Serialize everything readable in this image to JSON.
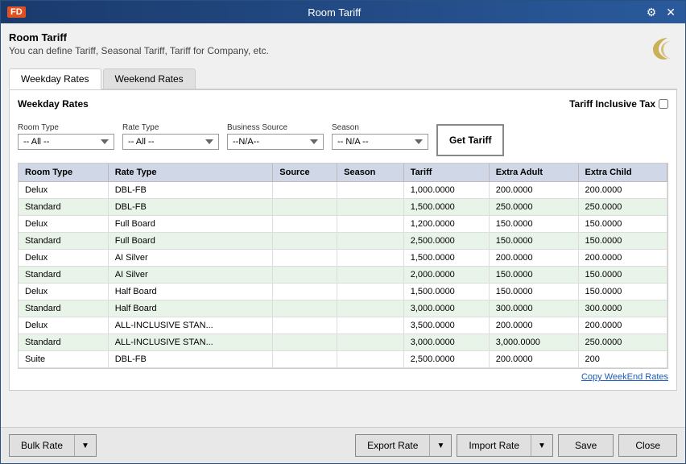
{
  "window": {
    "title": "Room Tariff",
    "logo": "FD",
    "controls": [
      "settings-icon",
      "close-icon"
    ]
  },
  "header": {
    "title": "Room Tariff",
    "subtitle": "You can define Tariff, Seasonal Tariff, Tariff for Company, etc."
  },
  "tabs": [
    {
      "id": "weekday",
      "label": "Weekday Rates",
      "active": true
    },
    {
      "id": "weekend",
      "label": "Weekend Rates",
      "active": false
    }
  ],
  "panel": {
    "title": "Weekday Rates",
    "tariff_inclusive_label": "Tariff Inclusive Tax",
    "filters": [
      {
        "id": "room_type",
        "label": "Room Type",
        "value": "-- All --",
        "options": [
          "-- All --"
        ]
      },
      {
        "id": "rate_type",
        "label": "Rate Type",
        "value": "-- All --",
        "options": [
          "-- All --"
        ]
      },
      {
        "id": "business_source",
        "label": "Business Source",
        "value": "--N/A--",
        "options": [
          "--N/A--"
        ]
      },
      {
        "id": "season",
        "label": "Season",
        "value": "-- N/A --",
        "options": [
          "-- N/A --"
        ]
      }
    ],
    "get_tariff_btn": "Get Tariff"
  },
  "table": {
    "columns": [
      "Room Type",
      "Rate Type",
      "Source",
      "Season",
      "Tariff",
      "Extra Adult",
      "Extra Child"
    ],
    "rows": [
      {
        "room_type": "Delux",
        "rate_type": "DBL-FB",
        "source": "",
        "season": "",
        "tariff": "1,000.0000",
        "extra_adult": "200.0000",
        "extra_child": "200.0000"
      },
      {
        "room_type": "Standard",
        "rate_type": "DBL-FB",
        "source": "",
        "season": "",
        "tariff": "1,500.0000",
        "extra_adult": "250.0000",
        "extra_child": "250.0000"
      },
      {
        "room_type": "Delux",
        "rate_type": "Full Board",
        "source": "",
        "season": "",
        "tariff": "1,200.0000",
        "extra_adult": "150.0000",
        "extra_child": "150.0000"
      },
      {
        "room_type": "Standard",
        "rate_type": "Full Board",
        "source": "",
        "season": "",
        "tariff": "2,500.0000",
        "extra_adult": "150.0000",
        "extra_child": "150.0000"
      },
      {
        "room_type": "Delux",
        "rate_type": "AI Silver",
        "source": "",
        "season": "",
        "tariff": "1,500.0000",
        "extra_adult": "200.0000",
        "extra_child": "200.0000"
      },
      {
        "room_type": "Standard",
        "rate_type": "AI Silver",
        "source": "",
        "season": "",
        "tariff": "2,000.0000",
        "extra_adult": "150.0000",
        "extra_child": "150.0000"
      },
      {
        "room_type": "Delux",
        "rate_type": "Half Board",
        "source": "",
        "season": "",
        "tariff": "1,500.0000",
        "extra_adult": "150.0000",
        "extra_child": "150.0000"
      },
      {
        "room_type": "Standard",
        "rate_type": "Half Board",
        "source": "",
        "season": "",
        "tariff": "3,000.0000",
        "extra_adult": "300.0000",
        "extra_child": "300.0000"
      },
      {
        "room_type": "Delux",
        "rate_type": "ALL-INCLUSIVE STAN...",
        "source": "",
        "season": "",
        "tariff": "3,500.0000",
        "extra_adult": "200.0000",
        "extra_child": "200.0000"
      },
      {
        "room_type": "Standard",
        "rate_type": "ALL-INCLUSIVE STAN...",
        "source": "",
        "season": "",
        "tariff": "3,000.0000",
        "extra_adult": "3,000.0000",
        "extra_child": "250.0000"
      },
      {
        "room_type": "Suite",
        "rate_type": "DBL-FB",
        "source": "",
        "season": "",
        "tariff": "2,500.0000",
        "extra_adult": "200.0000",
        "extra_child": "200"
      }
    ]
  },
  "copy_weekend_label": "Copy WeekEnd Rates",
  "footer": {
    "bulk_rate_label": "Bulk Rate",
    "export_rate_label": "Export Rate",
    "import_rate_label": "Import Rate",
    "save_label": "Save",
    "close_label": "Close"
  }
}
